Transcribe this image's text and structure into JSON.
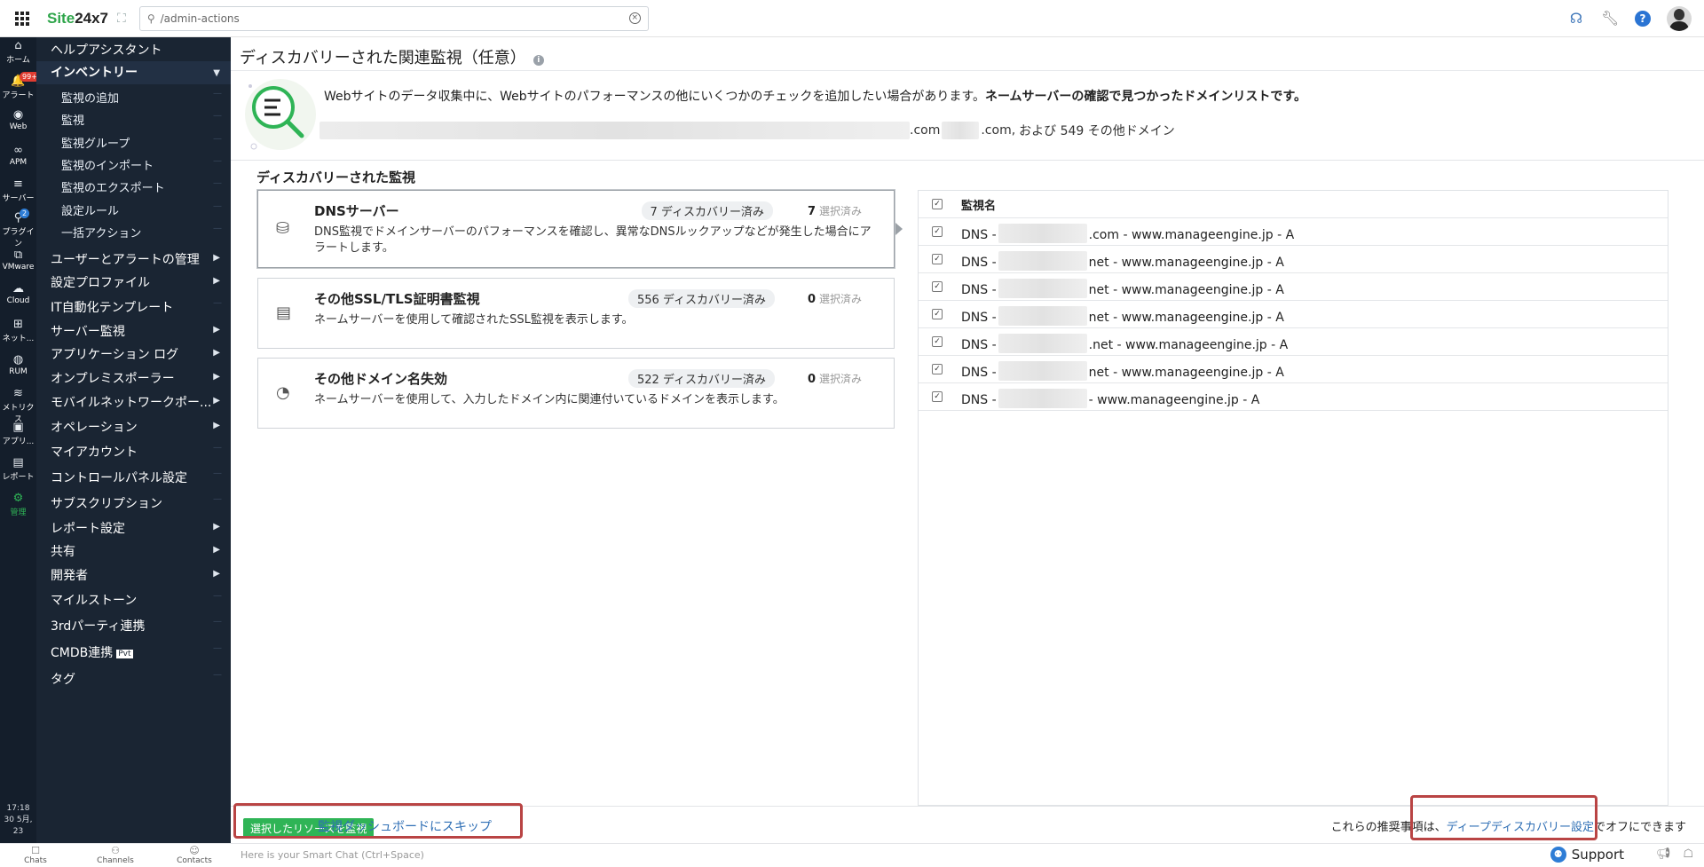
{
  "topbar": {
    "brand_prefix": "Site",
    "brand_suffix": "24x7",
    "search_value": "/admin-actions"
  },
  "rail": [
    {
      "label": "ホーム",
      "icon": "home-icon",
      "glyph": "⌂"
    },
    {
      "label": "アラート",
      "icon": "bell-icon",
      "glyph": "🔔",
      "badge": "99+"
    },
    {
      "label": "Web",
      "icon": "globe-icon",
      "glyph": "◉"
    },
    {
      "label": "APM",
      "icon": "apm-icon",
      "glyph": "∞"
    },
    {
      "label": "サーバー",
      "icon": "server-icon",
      "glyph": "≡"
    },
    {
      "label": "プラグイン",
      "icon": "plugin-icon",
      "glyph": "⚲",
      "badge": "2"
    },
    {
      "label": "VMware",
      "icon": "vmware-icon",
      "glyph": "⧉"
    },
    {
      "label": "Cloud",
      "icon": "cloud-icon",
      "glyph": "☁"
    },
    {
      "label": "ネット...",
      "icon": "network-icon",
      "glyph": "⊞"
    },
    {
      "label": "RUM",
      "icon": "rum-icon",
      "glyph": "◍"
    },
    {
      "label": "メトリクス",
      "icon": "metrics-icon",
      "glyph": "≋"
    },
    {
      "label": "アプリ...",
      "icon": "app-icon",
      "glyph": "▣"
    },
    {
      "label": "レポート",
      "icon": "report-icon",
      "glyph": "▤"
    },
    {
      "label": "管理",
      "icon": "gear-icon",
      "glyph": "⚙"
    }
  ],
  "rail_time": "17:18",
  "rail_date": "30 5月, 23",
  "menu": {
    "help": "ヘルプアシスタント",
    "inventory": "インベントリー",
    "inventory_items": [
      "監視の追加",
      "監視",
      "監視グループ",
      "監視のインポート",
      "監視のエクスポート",
      "設定ルール",
      "一括アクション"
    ],
    "items": [
      "ユーザーとアラートの管理",
      "設定プロファイル",
      "IT自動化テンプレート",
      "サーバー監視",
      "アプリケーション ログ",
      "オンプレミスポーラー",
      "モバイルネットワークポー...",
      "オペレーション",
      "マイアカウント",
      "コントロールパネル設定",
      "サブスクリプション",
      "レポート設定",
      "共有",
      "開発者",
      "マイルストーン",
      "3rdパーティ連携",
      "CMDB連携",
      "タグ"
    ],
    "pvt_label": "Pvt"
  },
  "page": {
    "title": "ディスカバリーされた関連監視（任意）",
    "info_glyph": "i",
    "banner_text": "Webサイトのデータ収集中に、Webサイトのパフォーマンスの他にいくつかのチェックを追加したい場合があります。",
    "banner_bold": "ネームサーバーの確認で見つかったドメインリストです。",
    "domains_com1": ".com",
    "domains_com2": ".com,",
    "domains_more": "および 549 その他ドメイン",
    "section_title": "ディスカバリーされた監視"
  },
  "cards": [
    {
      "title": "DNSサーバー",
      "desc": "DNS監視でドメインサーバーのパフォーマンスを確認し、異常なDNSルックアップなどが発生した場合にアラートします。",
      "discovered": "7 ディスカバリー済み",
      "selected_count": "7",
      "selected_label": "選択済み",
      "icon": "dns-icon",
      "glyph": "⛁"
    },
    {
      "title": "その他SSL/TLS証明書監視",
      "desc": "ネームサーバーを使用して確認されたSSL監視を表示します。",
      "discovered": "556 ディスカバリー済み",
      "selected_count": "0",
      "selected_label": "選択済み",
      "icon": "ssl-certificate-icon",
      "glyph": "▤"
    },
    {
      "title": "その他ドメイン名失効",
      "desc": "ネームサーバーを使用して、入力したドメイン内に関連付いているドメインを表示します。",
      "discovered": "522 ディスカバリー済み",
      "selected_count": "0",
      "selected_label": "選択済み",
      "icon": "domain-expiry-icon",
      "glyph": "◔"
    }
  ],
  "monitors": {
    "header": "監視名",
    "rows": [
      {
        "prefix": "DNS -",
        "suffix": ".com - www.manageengine.jp - A"
      },
      {
        "prefix": "DNS -",
        "suffix": "net - www.manageengine.jp - A"
      },
      {
        "prefix": "DNS -",
        "suffix": "net - www.manageengine.jp - A"
      },
      {
        "prefix": "DNS -",
        "suffix": "net - www.manageengine.jp - A"
      },
      {
        "prefix": "DNS -",
        "suffix": ".net - www.manageengine.jp - A"
      },
      {
        "prefix": "DNS -",
        "suffix": "net - www.manageengine.jp - A"
      },
      {
        "prefix": "DNS -",
        "suffix": "- www.manageengine.jp - A"
      }
    ]
  },
  "footer": {
    "primary_button": "選択したリソースを監視",
    "skip_link": "監視ダッシュボードにスキップ",
    "note_prefix": "これらの推奨事項は、",
    "note_link": "ディープディスカバリー設定",
    "note_suffix": "でオフにできます"
  },
  "bottombar": {
    "chats": "Chats",
    "channels": "Channels",
    "contacts": "Contacts",
    "smart_chat": "Here is your Smart Chat (Ctrl+Space)",
    "support": "Support"
  },
  "colors": {
    "accent_green": "#2fb456",
    "sidebar": "#1a2533",
    "rail": "#141e2b",
    "link": "#2f6fb5",
    "highlight": "#b94444"
  }
}
